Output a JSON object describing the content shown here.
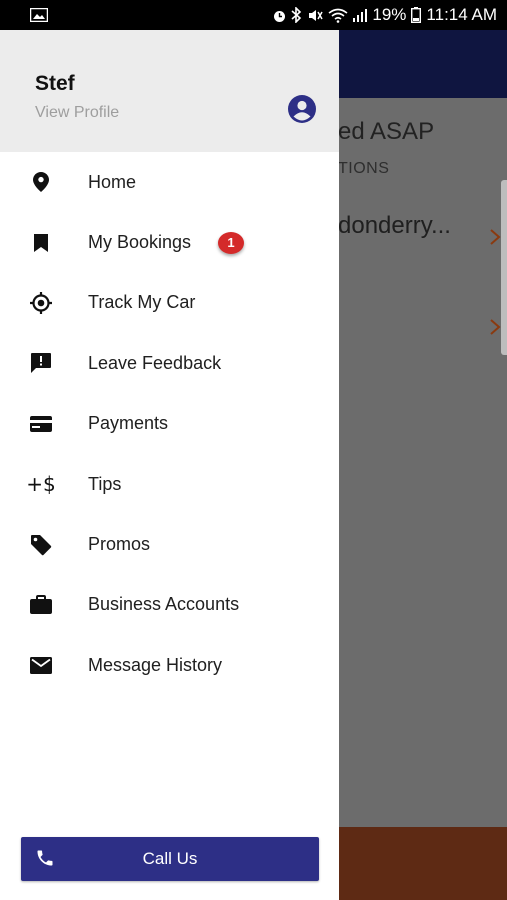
{
  "status_bar": {
    "battery": "19%",
    "time": "11:14 AM"
  },
  "background": {
    "title": "ed ASAP",
    "subtitle": "TIONS",
    "item": "donderry...",
    "chevron": "›"
  },
  "drawer": {
    "user_name": "Stef",
    "view_profile": "View Profile",
    "items": [
      {
        "label": "Home",
        "icon": "location-pin-icon"
      },
      {
        "label": "My Bookings",
        "icon": "bookmark-icon",
        "badge": "1"
      },
      {
        "label": "Track My Car",
        "icon": "gps-target-icon"
      },
      {
        "label": "Leave Feedback",
        "icon": "feedback-icon"
      },
      {
        "label": "Payments",
        "icon": "credit-card-icon"
      },
      {
        "label": "Tips",
        "icon": "tips-dollar-icon",
        "icon_text": "+$"
      },
      {
        "label": "Promos",
        "icon": "tag-icon"
      },
      {
        "label": "Business Accounts",
        "icon": "briefcase-icon"
      },
      {
        "label": "Message History",
        "icon": "envelope-icon"
      }
    ],
    "call_button": {
      "label": "Call Us"
    }
  },
  "colors": {
    "drawer_header_bg": "#ececec",
    "call_button_bg": "#2d2f86",
    "badge_bg": "#d42a2a",
    "profile_icon": "#2d2f86",
    "app_header": "#0f1540"
  }
}
